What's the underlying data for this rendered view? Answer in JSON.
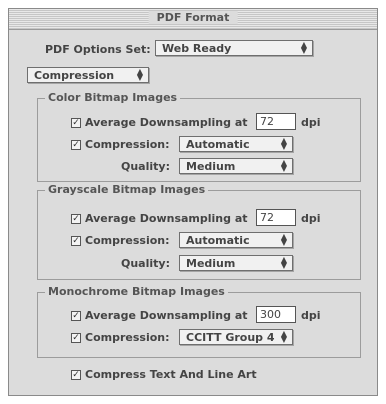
{
  "window": {
    "title": "PDF Format"
  },
  "options_set": {
    "label": "PDF Options Set:",
    "value": "Web Ready"
  },
  "section_popup": {
    "value": "Compression"
  },
  "color": {
    "title": "Color Bitmap Images",
    "downsample_label": "Average Downsampling at",
    "dpi_value": "72",
    "dpi_unit": "dpi",
    "compression_label": "Compression:",
    "compression_value": "Automatic",
    "quality_label": "Quality:",
    "quality_value": "Medium"
  },
  "grayscale": {
    "title": "Grayscale Bitmap Images",
    "downsample_label": "Average Downsampling at",
    "dpi_value": "72",
    "dpi_unit": "dpi",
    "compression_label": "Compression:",
    "compression_value": "Automatic",
    "quality_label": "Quality:",
    "quality_value": "Medium"
  },
  "mono": {
    "title": "Monochrome Bitmap Images",
    "downsample_label": "Average Downsampling at",
    "dpi_value": "300",
    "dpi_unit": "dpi",
    "compression_label": "Compression:",
    "compression_value": "CCITT Group 4"
  },
  "compress_text": {
    "label": "Compress Text And Line Art"
  }
}
